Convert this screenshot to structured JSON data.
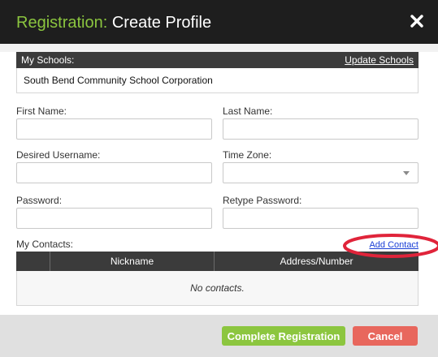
{
  "header": {
    "title_accent": "Registration:",
    "title_rest": "Create Profile"
  },
  "schools": {
    "label": "My Schools:",
    "update_link": "Update Schools",
    "items": [
      "South Bend Community School Corporation"
    ]
  },
  "form": {
    "first_name": {
      "label": "First Name:",
      "value": ""
    },
    "last_name": {
      "label": "Last Name:",
      "value": ""
    },
    "username": {
      "label": "Desired Username:",
      "value": ""
    },
    "time_zone": {
      "label": "Time Zone:",
      "value": ""
    },
    "password": {
      "label": "Password:",
      "value": ""
    },
    "retype_password": {
      "label": "Retype Password:",
      "value": ""
    }
  },
  "contacts": {
    "label": "My Contacts:",
    "add_link": "Add Contact",
    "columns": [
      "",
      "Nickname",
      "Address/Number"
    ],
    "empty_text": "No contacts."
  },
  "footer": {
    "complete_label": "Complete Registration",
    "cancel_label": "Cancel"
  },
  "colors": {
    "accent": "#8bc53f",
    "complete_button": "#8cc63f",
    "cancel_button": "#e8675d",
    "link": "#1a3fd6",
    "annotation": "#e0243a",
    "header_bg": "#1e1e1e",
    "table_header_bg": "#3b3b3b"
  },
  "icons": {
    "close": "close-icon",
    "dropdown": "chevron-down-icon"
  }
}
